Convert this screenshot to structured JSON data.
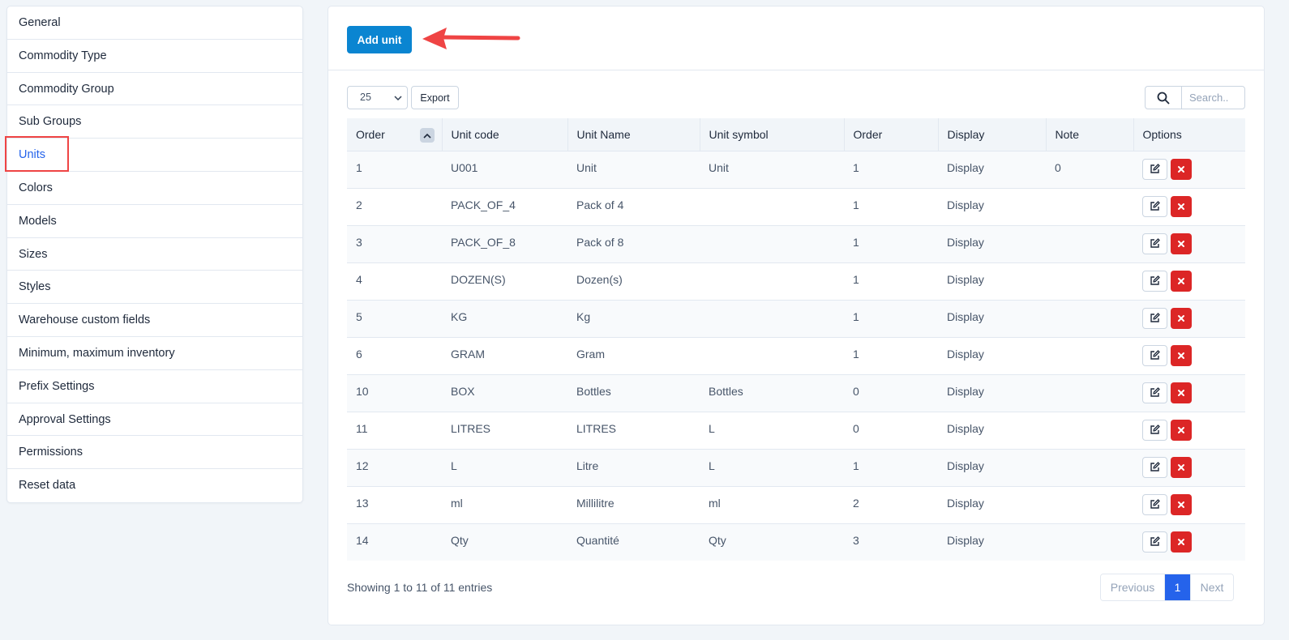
{
  "sidebar": {
    "items": [
      {
        "label": "General"
      },
      {
        "label": "Commodity Type"
      },
      {
        "label": "Commodity Group"
      },
      {
        "label": "Sub Groups"
      },
      {
        "label": "Units",
        "active": true
      },
      {
        "label": "Colors"
      },
      {
        "label": "Models"
      },
      {
        "label": "Sizes"
      },
      {
        "label": "Styles"
      },
      {
        "label": "Warehouse custom fields"
      },
      {
        "label": "Minimum, maximum inventory"
      },
      {
        "label": "Prefix Settings"
      },
      {
        "label": "Approval Settings"
      },
      {
        "label": "Permissions"
      },
      {
        "label": "Reset data"
      }
    ]
  },
  "toolbar": {
    "add_label": "Add unit",
    "page_length": "25",
    "export_label": "Export",
    "search_placeholder": "Search.."
  },
  "table": {
    "columns": [
      "Order",
      "Unit code",
      "Unit Name",
      "Unit symbol",
      "Order",
      "Display",
      "Note",
      "Options"
    ],
    "rows": [
      [
        "1",
        "U001",
        "Unit",
        "Unit",
        "1",
        "Display",
        "0"
      ],
      [
        "2",
        "PACK_OF_4",
        "Pack of 4",
        "",
        "1",
        "Display",
        ""
      ],
      [
        "3",
        "PACK_OF_8",
        "Pack of 8",
        "",
        "1",
        "Display",
        ""
      ],
      [
        "4",
        "DOZEN(S)",
        "Dozen(s)",
        "",
        "1",
        "Display",
        ""
      ],
      [
        "5",
        "KG",
        "Kg",
        "",
        "1",
        "Display",
        ""
      ],
      [
        "6",
        "GRAM",
        "Gram",
        "",
        "1",
        "Display",
        ""
      ],
      [
        "10",
        "BOX",
        "Bottles",
        "Bottles",
        "0",
        "Display",
        ""
      ],
      [
        "11",
        "LITRES",
        "LITRES",
        "L",
        "0",
        "Display",
        ""
      ],
      [
        "12",
        "L",
        "Litre",
        "L",
        "1",
        "Display",
        ""
      ],
      [
        "13",
        "ml",
        "Millilitre",
        "ml",
        "2",
        "Display",
        ""
      ],
      [
        "14",
        "Qty",
        "Quantité",
        "Qty",
        "3",
        "Display",
        ""
      ]
    ]
  },
  "footer": {
    "info": "Showing 1 to 11 of 11 entries",
    "previous": "Previous",
    "page": "1",
    "next": "Next"
  },
  "colors": {
    "primary": "#0a85d1",
    "active_link": "#2563eb",
    "danger": "#dc2626",
    "highlight": "#ef4444"
  }
}
